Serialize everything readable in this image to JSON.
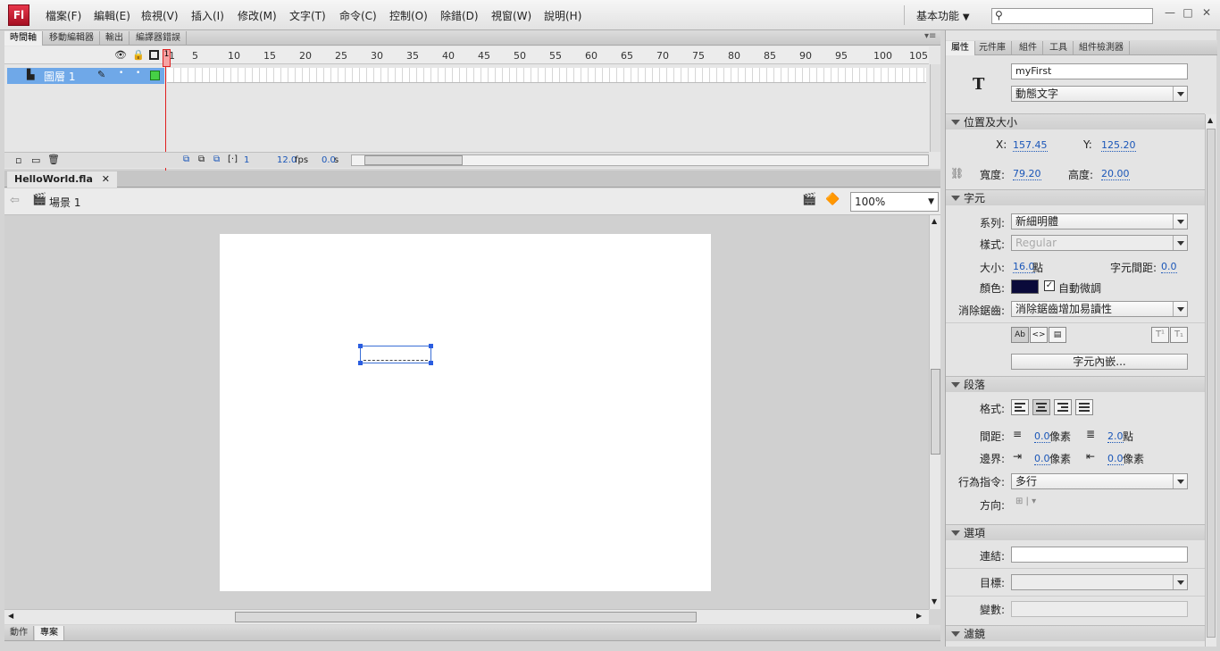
{
  "app": {
    "logo": "Fl"
  },
  "menu": [
    "檔案(F)",
    "編輯(E)",
    "檢視(V)",
    "插入(I)",
    "修改(M)",
    "文字(T)",
    "命令(C)",
    "控制(O)",
    "除錯(D)",
    "視窗(W)",
    "說明(H)"
  ],
  "workspace": "基本功能",
  "search": {
    "placeholder": ""
  },
  "top_tabs": [
    "時間軸",
    "移動編輯器",
    "輸出",
    "編譯器錯誤"
  ],
  "timeline": {
    "ruler": [
      "1",
      "5",
      "10",
      "15",
      "20",
      "25",
      "30",
      "35",
      "40",
      "45",
      "50",
      "55",
      "60",
      "65",
      "70",
      "75",
      "80",
      "85",
      "90",
      "95",
      "100",
      "105"
    ],
    "layer_name": "圖層 1",
    "current_frame": "1",
    "fps": "12.0",
    "fps_unit": "fps",
    "elapsed": "0.0",
    "elapsed_unit": "s"
  },
  "document": {
    "tab": "HelloWorld.fla",
    "scene": "場景 1",
    "zoom": "100%"
  },
  "bottom_tabs": [
    "動作",
    "專案"
  ],
  "props_tabs": [
    "屬性",
    "元件庫",
    "組件",
    "工具",
    "組件檢測器"
  ],
  "props": {
    "instance_name": "myFirst",
    "text_type": "動態文字",
    "section_position": "位置及大小",
    "x_label": "X:",
    "x_value": "157.45",
    "y_label": "Y:",
    "y_value": "125.20",
    "w_label": "寬度:",
    "w_value": "79.20",
    "h_label": "高度:",
    "h_value": "20.00",
    "section_char": "字元",
    "family_label": "系列:",
    "family_value": "新細明體",
    "style_label": "樣式:",
    "style_value": "Regular",
    "size_label": "大小:",
    "size_value": "16.0",
    "size_unit": "點",
    "spacing_label": "字元間距:",
    "spacing_value": "0.0",
    "color_label": "顏色:",
    "color_value": "#0a0a3a",
    "autokern_label": "自動微調",
    "antialias_label": "消除鋸齒:",
    "antialias_value": "消除鋸齒增加易讀性",
    "embed_button": "字元內嵌...",
    "section_para": "段落",
    "format_label": "格式:",
    "gap_label": "間距:",
    "gap_indent": "0.0",
    "gap_indent_unit": "像素",
    "gap_line": "2.0",
    "gap_line_unit": "點",
    "margin_label": "邊界:",
    "margin_left": "0.0",
    "margin_left_unit": "像素",
    "margin_right": "0.0",
    "margin_right_unit": "像素",
    "behavior_label": "行為指令:",
    "behavior_value": "多行",
    "direction_label": "方向:",
    "section_options": "選項",
    "link_label": "連結:",
    "target_label": "目標:",
    "var_label": "變數:",
    "section_filter": "濾鏡"
  }
}
